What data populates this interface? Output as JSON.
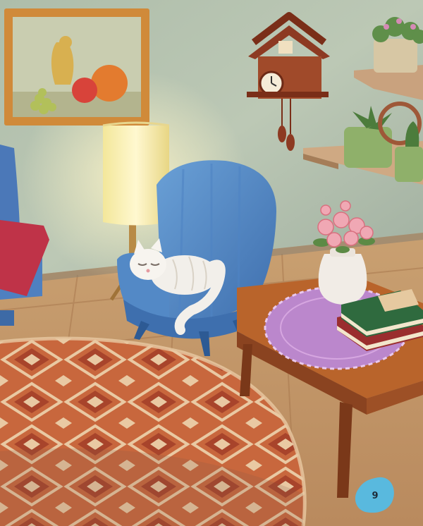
{
  "illustration": {
    "page_number": "9"
  },
  "colors": {
    "wall": "#b9c5b3",
    "floor": "#c89a6b",
    "armchair": "#5e8fc9",
    "rug": "#c8643a",
    "table": "#b8642c",
    "doily": "#b784c8",
    "page_badge": "#59b9de"
  }
}
